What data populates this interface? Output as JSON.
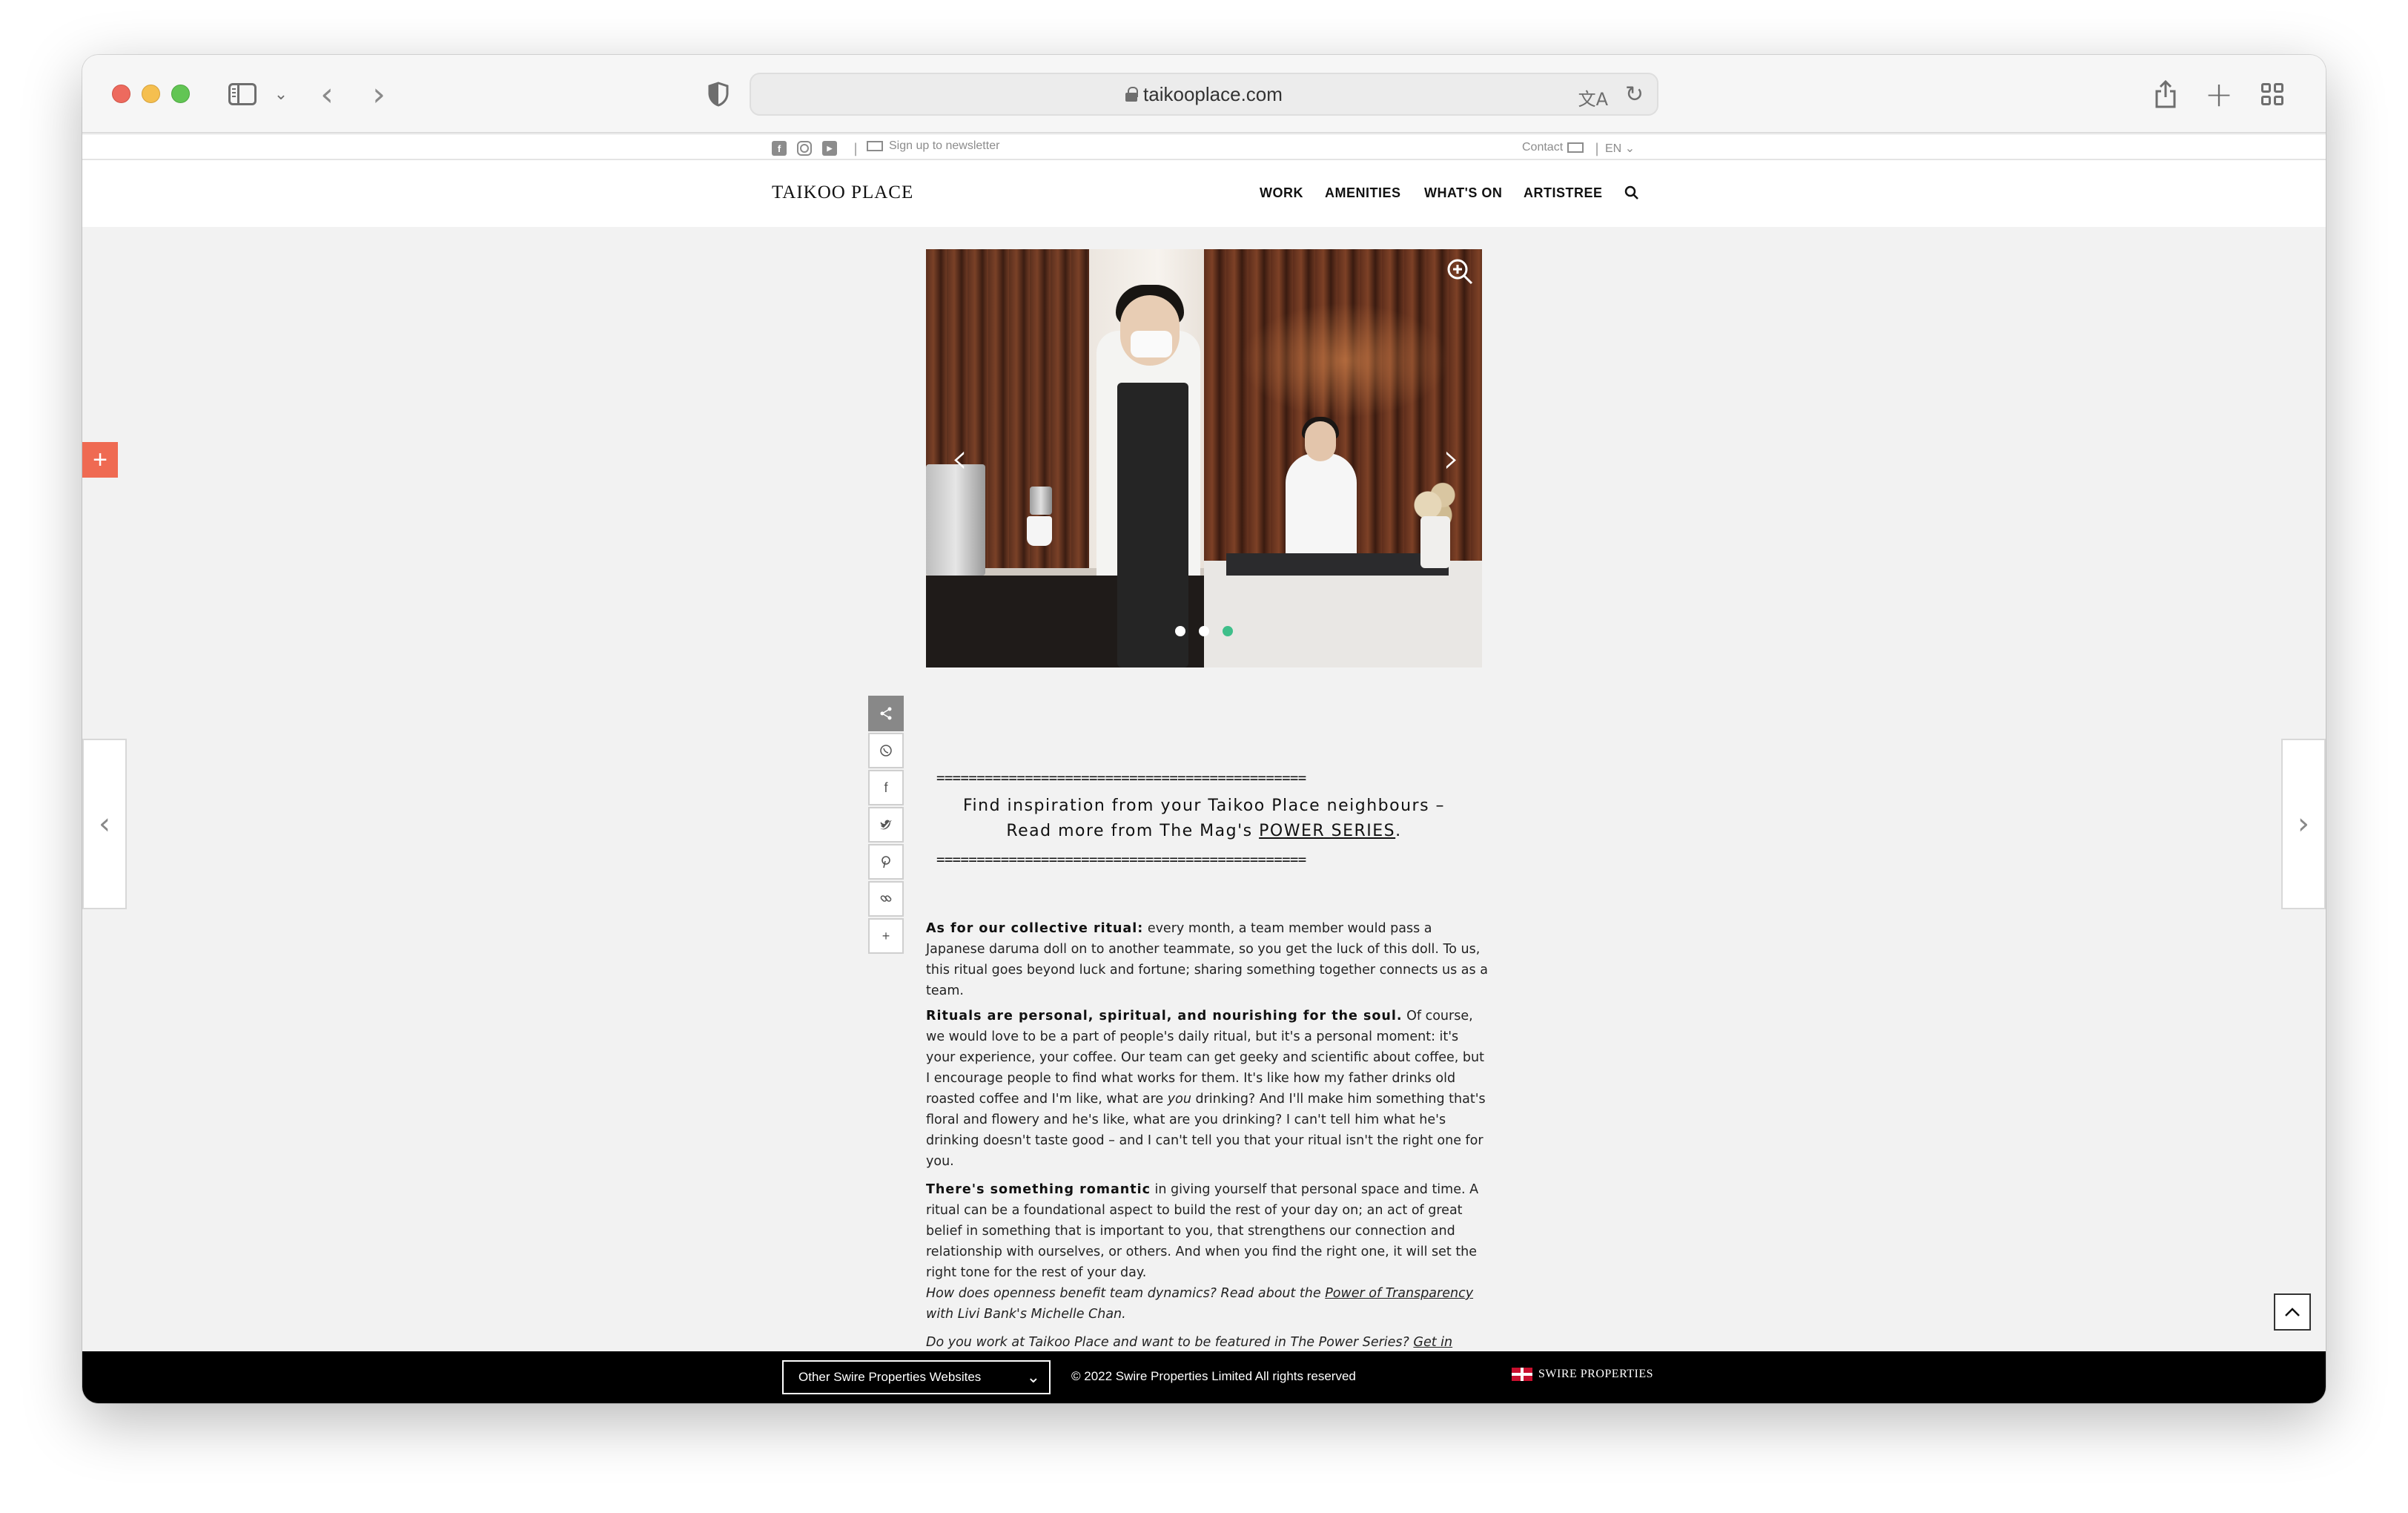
{
  "browser": {
    "url": "taikooplace.com",
    "icons": {
      "sidebar": "sidebar-icon",
      "back": "chevron-left-icon",
      "forward": "chevron-right-icon",
      "privacy": "shield-icon",
      "translate": "translate-icon",
      "reload": "reload-icon",
      "share": "share-icon",
      "new_tab": "plus-icon",
      "tab_overview": "grid-icon"
    }
  },
  "topbar": {
    "newsletter": "Sign up to newsletter",
    "contact": "Contact",
    "language": "EN"
  },
  "nav": {
    "logo": "TAIKOO PLACE",
    "items": [
      "WORK",
      "AMENITIES",
      "WHAT'S ON",
      "ARTISTREE"
    ]
  },
  "float_button": "+",
  "slider": {
    "prev": "‹",
    "next": "›",
    "dot_count": 3,
    "active_dot": 3
  },
  "share": {
    "items": [
      "whatsapp-icon",
      "facebook-icon",
      "twitter-icon",
      "pinterest-icon",
      "link-icon",
      "plus-icon"
    ]
  },
  "article": {
    "rule": "==============================================",
    "callout_line1": "Find inspiration from your Taikoo Place neighbours –",
    "callout_line2_prefix": "Read more from The Mag's ",
    "callout_link": "POWER SERIES",
    "callout_suffix": ".",
    "paragraphs": [
      {
        "lead": "As for our collective ritual:",
        "text": " every month, a team member would pass a Japanese daruma doll on to another teammate, so you get the luck of this doll. To us, this ritual goes beyond luck and fortune; sharing something together connects us as a team."
      },
      {
        "lead": "Rituals are personal, spiritual, and nourishing for the soul.",
        "text_before": " Of course, we would love to be a part of people's daily ritual, but it's a personal moment: it's your experience, your coffee. Our team can get geeky and scientific about coffee, but I encourage people to find what works for them. It's like how my father drinks old roasted coffee and I'm like, what are ",
        "emphasis": "you",
        "text_after": " drinking? And I'll make him something that's floral and flowery and he's like, what are you drinking? I can't tell him what he's drinking doesn't taste good – and I can't tell you that your ritual isn't the right one for you."
      },
      {
        "lead": "There's something romantic",
        "text": " in giving yourself that personal space and time. A ritual can be a foundational aspect to build the rest of your day on; an act of great belief in something that is important to you, that strengthens our connection and relationship with ourselves, or others. And when you find the right one, it will set the right tone for the rest of your day."
      }
    ],
    "italic1_prefix": "How does openness benefit team dynamics? Read about the ",
    "italic1_link": "Power of Transparency",
    "italic1_suffix": " with Livi Bank's Michelle Chan.",
    "italic2_prefix": "Do you work at Taikoo Place and want to be featured in The Power Series? ",
    "italic2_link": "Get in touch",
    "italic2_suffix": "."
  },
  "footer": {
    "select_label": "Other Swire Properties Websites",
    "copyright": "© 2022 Swire Properties Limited All rights reserved",
    "brand": "SWIRE PROPERTIES"
  }
}
